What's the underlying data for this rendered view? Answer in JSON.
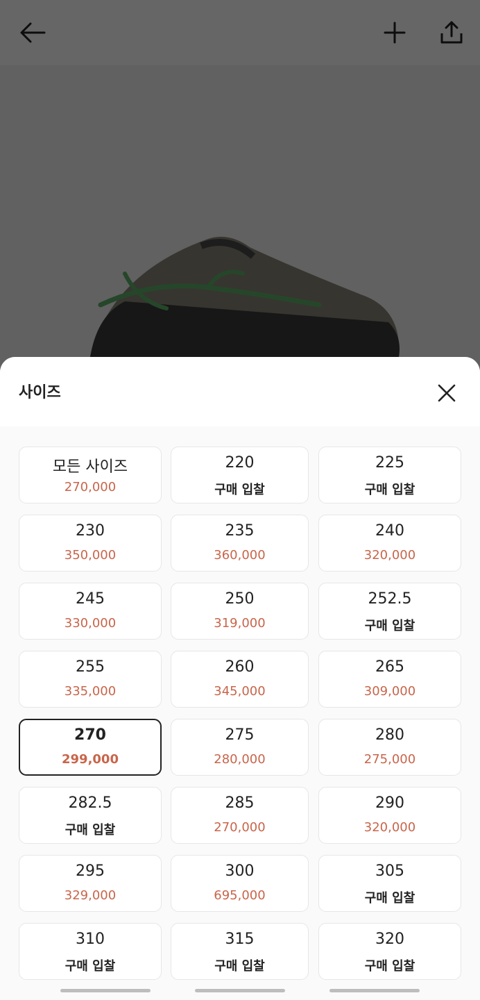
{
  "sheet": {
    "title": "사이즈",
    "sizes": [
      {
        "size": "모든 사이즈",
        "price": "270,000",
        "bid": false
      },
      {
        "size": "220",
        "price": "구매 입찰",
        "bid": true
      },
      {
        "size": "225",
        "price": "구매 입찰",
        "bid": true
      },
      {
        "size": "230",
        "price": "350,000",
        "bid": false
      },
      {
        "size": "235",
        "price": "360,000",
        "bid": false
      },
      {
        "size": "240",
        "price": "320,000",
        "bid": false
      },
      {
        "size": "245",
        "price": "330,000",
        "bid": false
      },
      {
        "size": "250",
        "price": "319,000",
        "bid": false
      },
      {
        "size": "252.5",
        "price": "구매 입찰",
        "bid": true
      },
      {
        "size": "255",
        "price": "335,000",
        "bid": false
      },
      {
        "size": "260",
        "price": "345,000",
        "bid": false
      },
      {
        "size": "265",
        "price": "309,000",
        "bid": false
      },
      {
        "size": "270",
        "price": "299,000",
        "bid": false,
        "selected": true
      },
      {
        "size": "275",
        "price": "280,000",
        "bid": false
      },
      {
        "size": "280",
        "price": "275,000",
        "bid": false
      },
      {
        "size": "282.5",
        "price": "구매 입찰",
        "bid": true
      },
      {
        "size": "285",
        "price": "270,000",
        "bid": false
      },
      {
        "size": "290",
        "price": "320,000",
        "bid": false
      },
      {
        "size": "295",
        "price": "329,000",
        "bid": false
      },
      {
        "size": "300",
        "price": "695,000",
        "bid": false
      },
      {
        "size": "305",
        "price": "구매 입찰",
        "bid": true
      },
      {
        "size": "310",
        "price": "구매 입찰",
        "bid": true
      },
      {
        "size": "315",
        "price": "구매 입찰",
        "bid": true
      },
      {
        "size": "320",
        "price": "구매 입찰",
        "bid": true
      }
    ]
  },
  "colors": {
    "price": "#c8654b",
    "text": "#222222",
    "selected_border": "#222222"
  },
  "icons": {
    "back": "arrow-left-icon",
    "add": "plus-icon",
    "share": "share-upload-icon",
    "close": "close-icon"
  }
}
